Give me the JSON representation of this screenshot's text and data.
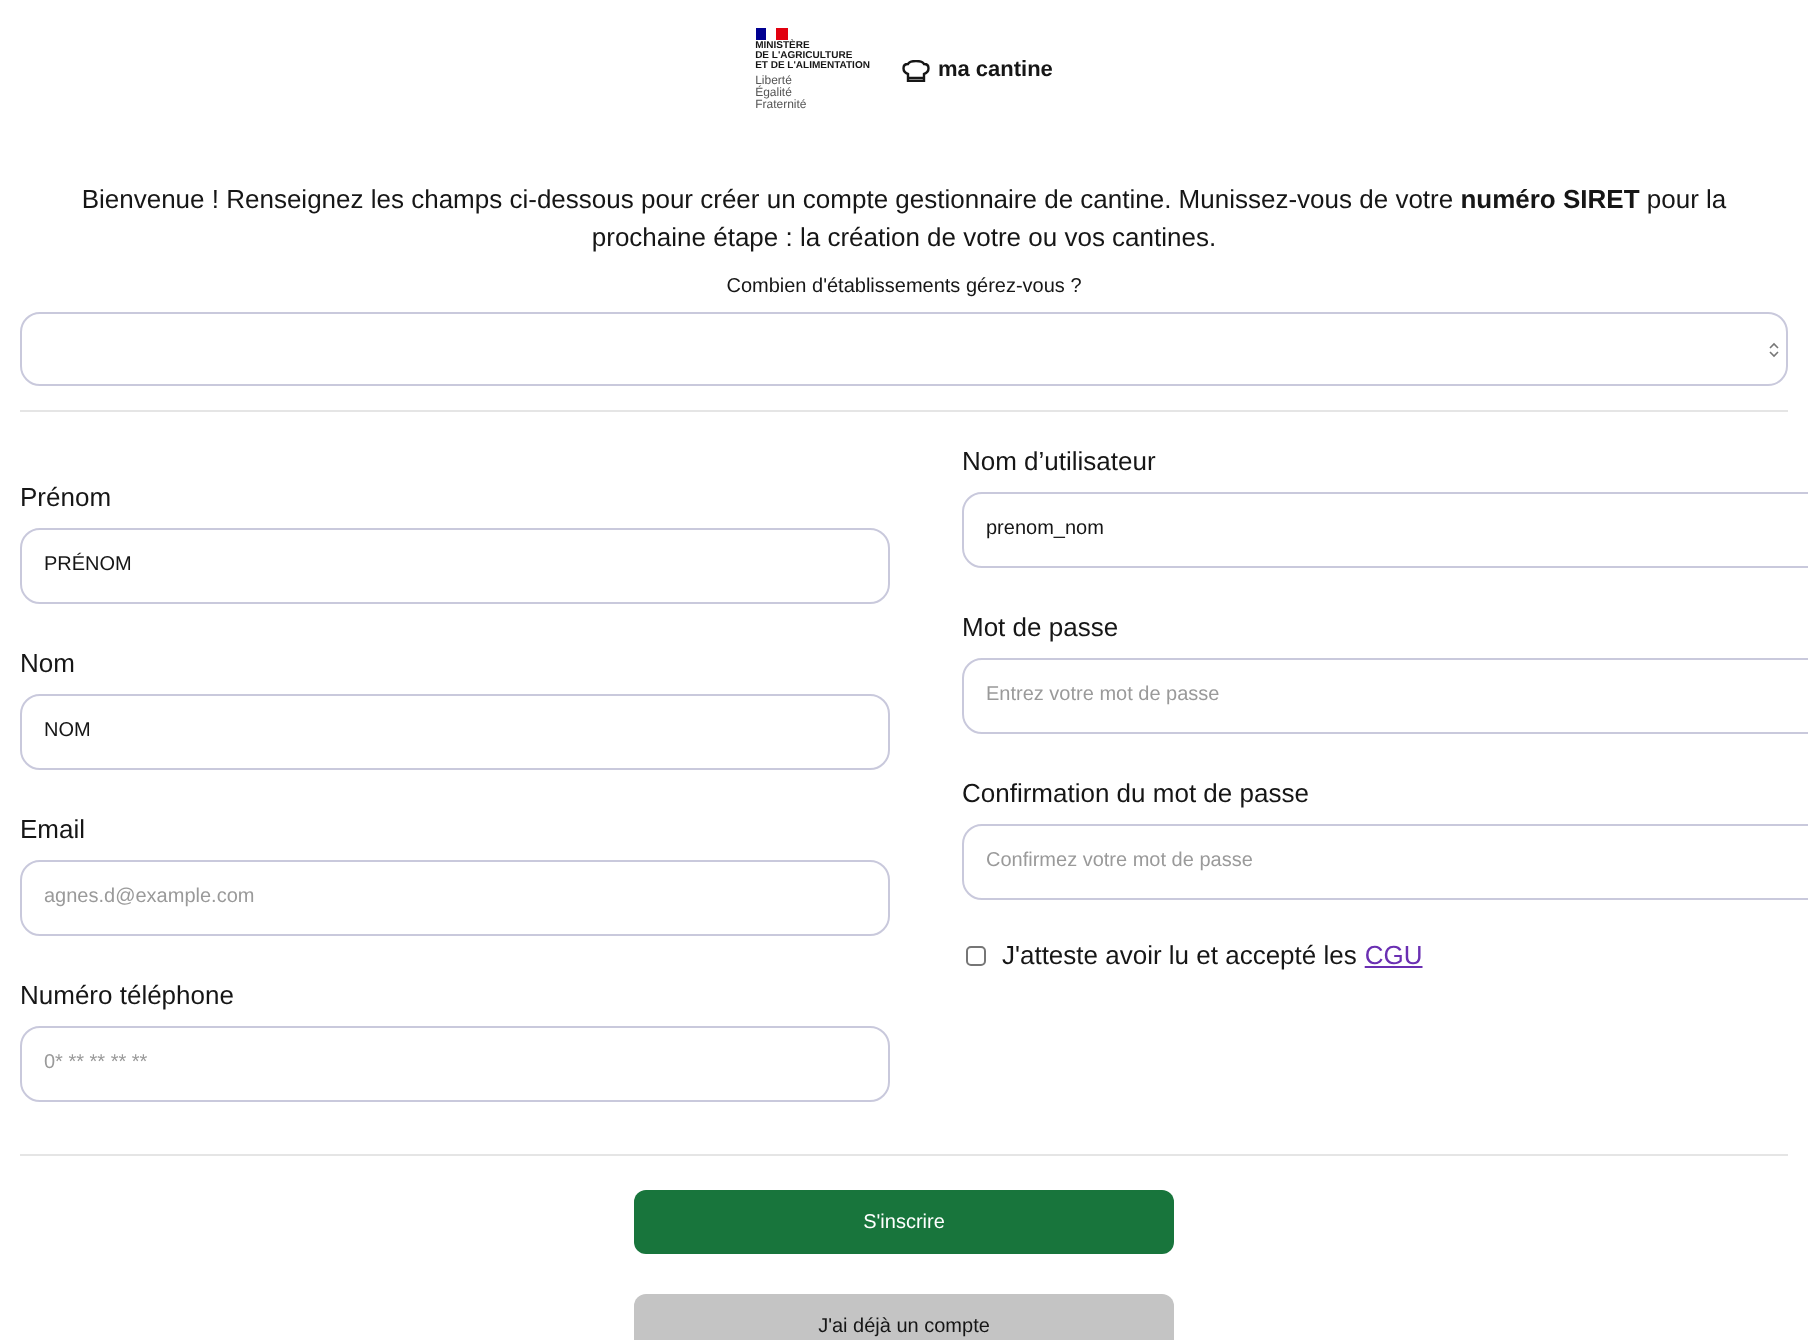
{
  "header": {
    "ministry": {
      "name": "MINISTÈRE\nDE L'AGRICULTURE\nET DE L'ALIMENTATION",
      "motto": "Liberté\nÉgalité\nFraternité"
    },
    "brand": "ma cantine"
  },
  "intro": "Bienvenue ! Renseignez les champs ci-dessous pour créer un compte gestionnaire de cantine. Munissez-vous de votre **numéro SIRET** pour la prochaine étape : la création de votre ou vos cantines.",
  "establishments": {
    "label": "Combien d'établissements gérez-vous ?",
    "kind": "number"
  },
  "left_fields": [
    {
      "label": "Prénom",
      "value": "PRÉNOM"
    },
    {
      "label": "Nom",
      "value": "NOM"
    },
    {
      "label": "Email",
      "placeholder": "agnes.d@example.com"
    },
    {
      "label": "Numéro téléphone",
      "placeholder": "0* ** ** ** **"
    }
  ],
  "right_fields": [
    {
      "label": "Nom d’utilisateur",
      "value": "prenom_nom"
    },
    {
      "label": "Mot de passe",
      "placeholder": "Entrez votre mot de passe"
    },
    {
      "label": "Confirmation du mot de passe",
      "placeholder": "Confirmez votre mot de passe"
    }
  ],
  "terms": {
    "checked": false,
    "text": "J'atteste avoir lu et accepté les",
    "link": "CGU"
  },
  "buttons": [
    {
      "label": "S'inscrire",
      "kind": "primary"
    },
    {
      "label": "J'ai déjà un compte",
      "kind": "secondary"
    }
  ]
}
